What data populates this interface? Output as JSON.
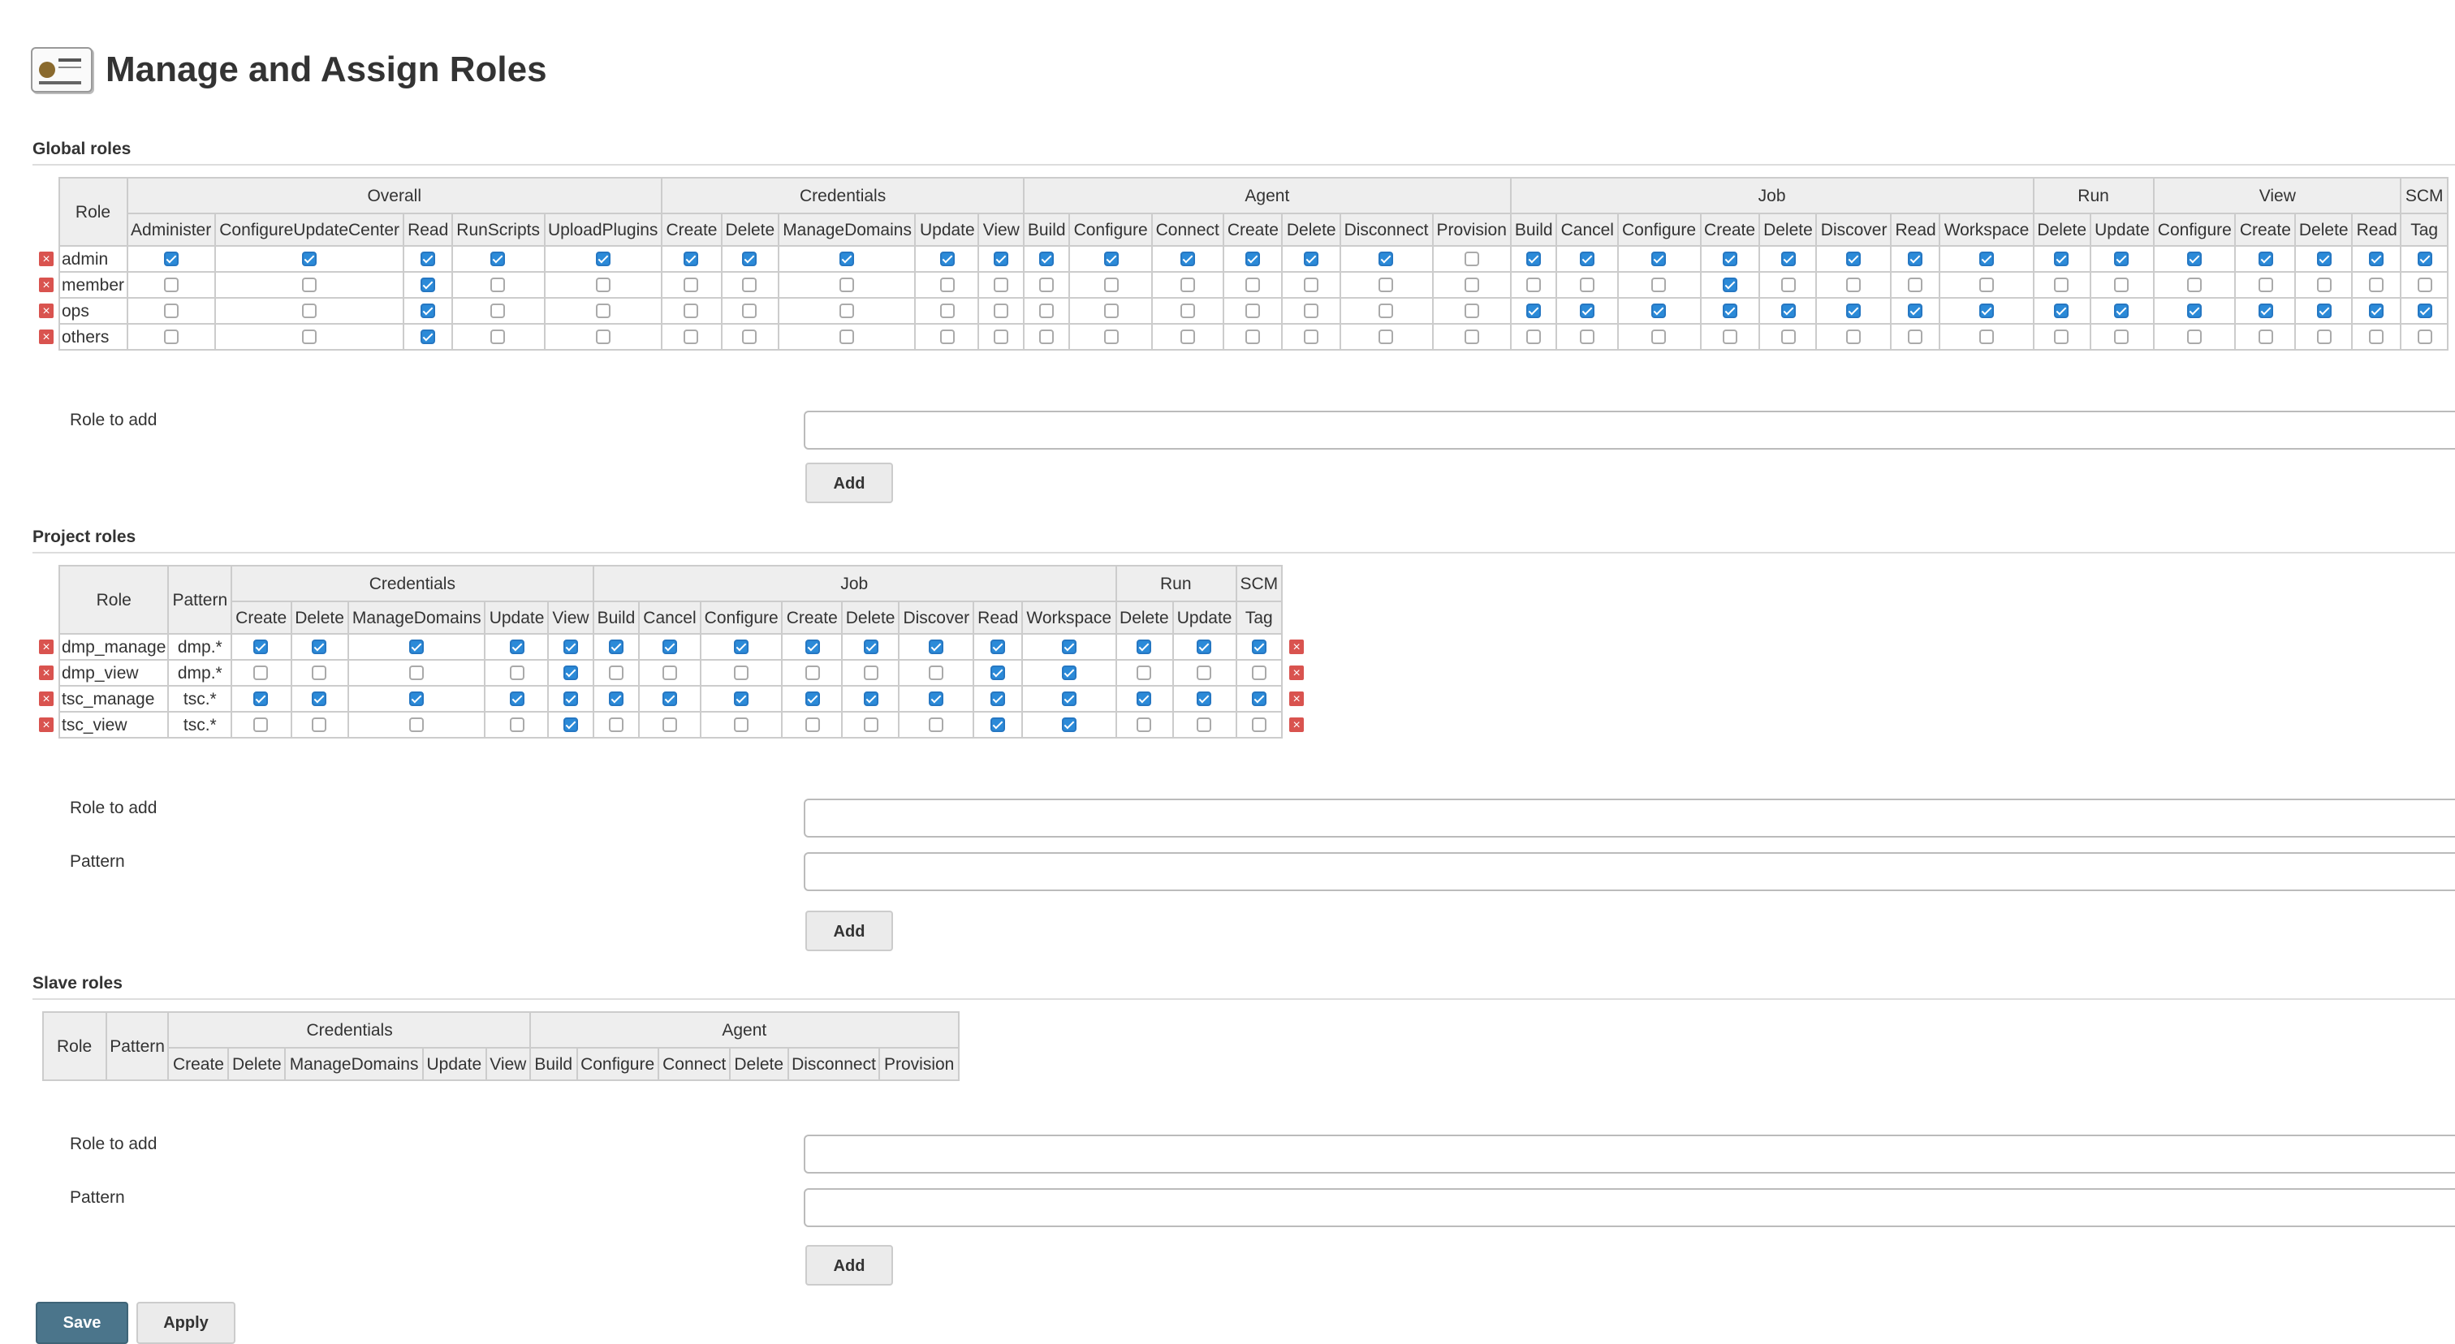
{
  "page": {
    "title": "Manage and Assign Roles"
  },
  "global": {
    "title": "Global roles",
    "role_header": "Role",
    "groups": [
      {
        "label": "Overall",
        "cols": [
          "Administer",
          "ConfigureUpdateCenter",
          "Read",
          "RunScripts",
          "UploadPlugins"
        ]
      },
      {
        "label": "Credentials",
        "cols": [
          "Create",
          "Delete",
          "ManageDomains",
          "Update",
          "View"
        ]
      },
      {
        "label": "Agent",
        "cols": [
          "Build",
          "Configure",
          "Connect",
          "Create",
          "Delete",
          "Disconnect",
          "Provision"
        ]
      },
      {
        "label": "Job",
        "cols": [
          "Build",
          "Cancel",
          "Configure",
          "Create",
          "Delete",
          "Discover",
          "Read",
          "Workspace"
        ]
      },
      {
        "label": "Run",
        "cols": [
          "Delete",
          "Update"
        ]
      },
      {
        "label": "View",
        "cols": [
          "Configure",
          "Create",
          "Delete",
          "Read"
        ]
      },
      {
        "label": "SCM",
        "cols": [
          "Tag"
        ]
      }
    ],
    "rows": [
      {
        "name": "admin",
        "checks": [
          1,
          1,
          1,
          1,
          1,
          1,
          1,
          1,
          1,
          1,
          1,
          1,
          1,
          1,
          1,
          1,
          0,
          1,
          1,
          1,
          1,
          1,
          1,
          1,
          1,
          1,
          1,
          1,
          1,
          1,
          1,
          1
        ]
      },
      {
        "name": "member",
        "checks": [
          0,
          0,
          1,
          0,
          0,
          0,
          0,
          0,
          0,
          0,
          0,
          0,
          0,
          0,
          0,
          0,
          0,
          0,
          0,
          0,
          1,
          0,
          0,
          0,
          0,
          0,
          0,
          0,
          0,
          0,
          0,
          0
        ]
      },
      {
        "name": "ops",
        "checks": [
          0,
          0,
          1,
          0,
          0,
          0,
          0,
          0,
          0,
          0,
          0,
          0,
          0,
          0,
          0,
          0,
          0,
          1,
          1,
          1,
          1,
          1,
          1,
          1,
          1,
          1,
          1,
          1,
          1,
          1,
          1,
          1
        ]
      },
      {
        "name": "others",
        "checks": [
          0,
          0,
          1,
          0,
          0,
          0,
          0,
          0,
          0,
          0,
          0,
          0,
          0,
          0,
          0,
          0,
          0,
          0,
          0,
          0,
          0,
          0,
          0,
          0,
          0,
          0,
          0,
          0,
          0,
          0,
          0,
          0
        ]
      }
    ],
    "role_to_add_label": "Role to add",
    "role_to_add_value": "",
    "add_label": "Add"
  },
  "project": {
    "title": "Project roles",
    "role_header": "Role",
    "pattern_header": "Pattern",
    "groups": [
      {
        "label": "Credentials",
        "cols": [
          "Create",
          "Delete",
          "ManageDomains",
          "Update",
          "View"
        ]
      },
      {
        "label": "Job",
        "cols": [
          "Build",
          "Cancel",
          "Configure",
          "Create",
          "Delete",
          "Discover",
          "Read",
          "Workspace"
        ]
      },
      {
        "label": "Run",
        "cols": [
          "Delete",
          "Update"
        ]
      },
      {
        "label": "SCM",
        "cols": [
          "Tag"
        ]
      }
    ],
    "rows": [
      {
        "name": "dmp_manage",
        "pattern": "dmp.*",
        "checks": [
          1,
          1,
          1,
          1,
          1,
          1,
          1,
          1,
          1,
          1,
          1,
          1,
          1,
          1,
          1,
          1
        ]
      },
      {
        "name": "dmp_view",
        "pattern": "dmp.*",
        "checks": [
          0,
          0,
          0,
          0,
          1,
          0,
          0,
          0,
          0,
          0,
          0,
          1,
          1,
          0,
          0,
          0
        ]
      },
      {
        "name": "tsc_manage",
        "pattern": "tsc.*",
        "checks": [
          1,
          1,
          1,
          1,
          1,
          1,
          1,
          1,
          1,
          1,
          1,
          1,
          1,
          1,
          1,
          1
        ]
      },
      {
        "name": "tsc_view",
        "pattern": "tsc.*",
        "checks": [
          0,
          0,
          0,
          0,
          1,
          0,
          0,
          0,
          0,
          0,
          0,
          1,
          1,
          0,
          0,
          0
        ]
      }
    ],
    "role_to_add_label": "Role to add",
    "pattern_label": "Pattern",
    "add_label": "Add"
  },
  "slave": {
    "title": "Slave roles",
    "role_header": "Role",
    "pattern_header": "Pattern",
    "groups": [
      {
        "label": "Credentials",
        "cols": [
          "Create",
          "Delete",
          "ManageDomains",
          "Update",
          "View"
        ]
      },
      {
        "label": "Agent",
        "cols": [
          "Build",
          "Configure",
          "Connect",
          "Delete",
          "Disconnect",
          "Provision"
        ]
      }
    ],
    "role_to_add_label": "Role to add",
    "pattern_label": "Pattern",
    "add_label": "Add"
  },
  "footer": {
    "save_label": "Save",
    "apply_label": "Apply"
  }
}
